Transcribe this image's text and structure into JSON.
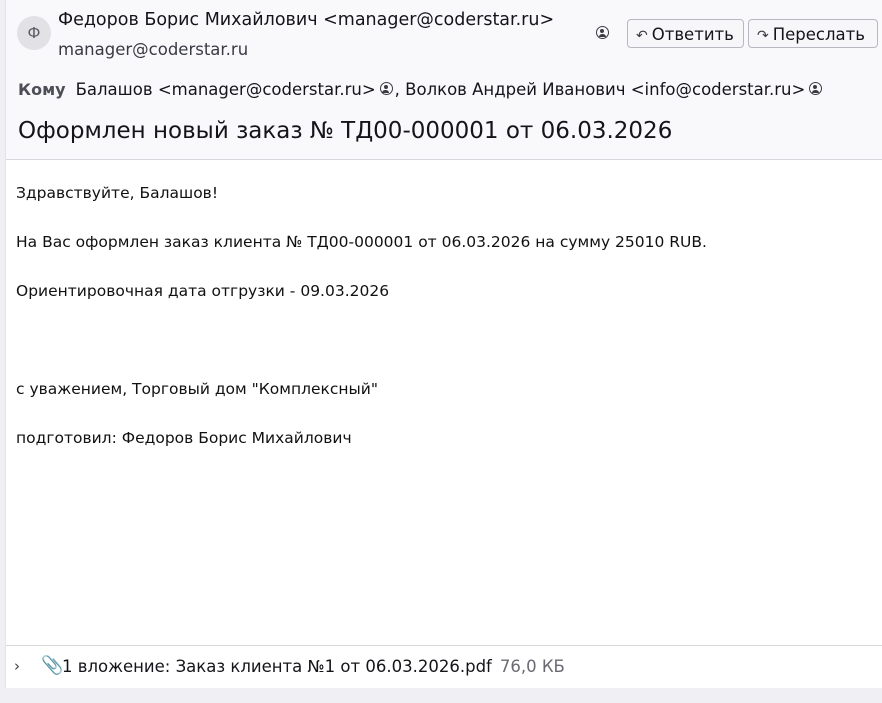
{
  "header": {
    "avatar_letter": "Ф",
    "from_display": "Федоров Борис Михайлович <manager@coderstar.ru>",
    "from_email": "manager@coderstar.ru",
    "reply_label": "Ответить",
    "forward_label": "Переслать",
    "to_label": "Кому",
    "recipients": [
      "Балашов <manager@coderstar.ru>",
      "Волков Андрей Иванович <info@coderstar.ru>"
    ],
    "recipient_separator": ",",
    "subject": "Оформлен новый заказ № ТД00-000001 от 06.03.2026"
  },
  "message": {
    "greeting": "Здравствуйте, Балашов!",
    "order_line": "На Вас оформлен заказ клиента № ТД00-000001 от 06.03.2026 на сумму 25010 RUB.",
    "shipping_line": "Ориентировочная дата отгрузки - 09.03.2026",
    "regards_line": "с уважением, Торговый дом \"Комплексный\"",
    "prepared_line": "подготовил: Федоров Борис Михайлович"
  },
  "attachments": {
    "summary": "1 вложение: Заказ клиента №1 от 06.03.2026.pdf",
    "size": "76,0 КБ"
  },
  "icons": {
    "contact": "contact-icon",
    "reply": "reply-icon",
    "forward": "forward-icon",
    "expand": "chevron-right-icon",
    "attachment": "paperclip-icon"
  }
}
